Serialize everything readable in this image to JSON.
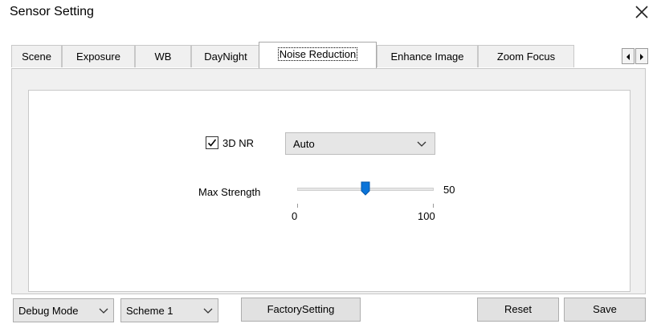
{
  "window": {
    "title": "Sensor Setting",
    "close_icon": "close-icon"
  },
  "tabs": [
    {
      "label": "Scene"
    },
    {
      "label": "Exposure"
    },
    {
      "label": "WB"
    },
    {
      "label": "DayNight"
    },
    {
      "label": "Noise Reduction",
      "active": true
    },
    {
      "label": "Enhance Image"
    },
    {
      "label": "Zoom Focus"
    }
  ],
  "tab_scroll": {
    "left_icon": "arrow-left-icon",
    "right_icon": "arrow-right-icon"
  },
  "noise_reduction": {
    "nr3d": {
      "label": "3D NR",
      "checked": true
    },
    "mode_select": {
      "value": "Auto"
    },
    "max_strength": {
      "label": "Max Strength",
      "value": 50,
      "value_text": "50",
      "min_text": "0",
      "max_text": "100",
      "min": 0,
      "max": 100
    }
  },
  "footer": {
    "debug_mode": "Debug Mode",
    "scheme": "Scheme 1",
    "factory_setting": "FactorySetting",
    "reset": "Reset",
    "save": "Save"
  }
}
